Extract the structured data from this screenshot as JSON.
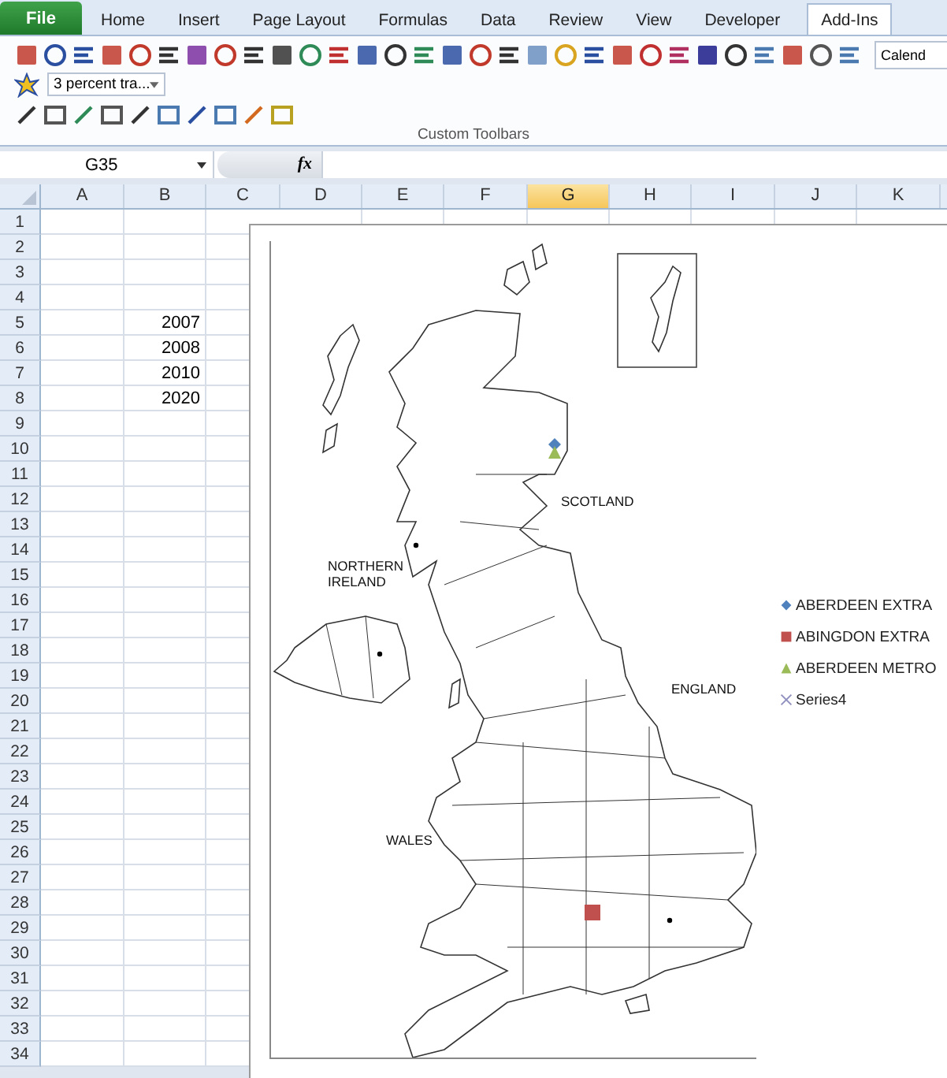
{
  "ribbon": {
    "file_tab": "File",
    "tabs": [
      {
        "label": "Home",
        "selected": false
      },
      {
        "label": "Insert",
        "selected": false
      },
      {
        "label": "Page Layout",
        "selected": false
      },
      {
        "label": "Formulas",
        "selected": false
      },
      {
        "label": "Data",
        "selected": false
      },
      {
        "label": "Review",
        "selected": false
      },
      {
        "label": "View",
        "selected": false
      },
      {
        "label": "Developer",
        "selected": false
      },
      {
        "label": "Add-Ins",
        "selected": true
      }
    ],
    "calendar_field": "Calend",
    "dropdown": "3 percent tra...",
    "group_label": "Custom Toolbars"
  },
  "formula_bar": {
    "name_box": "G35",
    "fx": "fx"
  },
  "sheet": {
    "columns": [
      {
        "label": "A",
        "selected": false
      },
      {
        "label": "B",
        "selected": false
      },
      {
        "label": "C",
        "selected": false
      },
      {
        "label": "D",
        "selected": false
      },
      {
        "label": "E",
        "selected": false
      },
      {
        "label": "F",
        "selected": false
      },
      {
        "label": "G",
        "selected": true
      },
      {
        "label": "H",
        "selected": false
      },
      {
        "label": "I",
        "selected": false
      },
      {
        "label": "J",
        "selected": false
      },
      {
        "label": "K",
        "selected": false
      }
    ],
    "rows": [
      {
        "label": "1"
      },
      {
        "label": "2"
      },
      {
        "label": "3"
      },
      {
        "label": "4"
      },
      {
        "label": "5",
        "B": "2007"
      },
      {
        "label": "6",
        "B": "2008"
      },
      {
        "label": "7",
        "B": "2010"
      },
      {
        "label": "8",
        "B": "2020"
      },
      {
        "label": "9"
      },
      {
        "label": "10"
      },
      {
        "label": "11"
      },
      {
        "label": "12"
      },
      {
        "label": "13"
      },
      {
        "label": "14"
      },
      {
        "label": "15"
      },
      {
        "label": "16"
      },
      {
        "label": "17"
      },
      {
        "label": "18"
      },
      {
        "label": "19"
      },
      {
        "label": "20"
      },
      {
        "label": "21"
      },
      {
        "label": "22"
      },
      {
        "label": "23"
      },
      {
        "label": "24"
      },
      {
        "label": "25"
      },
      {
        "label": "26"
      },
      {
        "label": "27"
      },
      {
        "label": "28"
      },
      {
        "label": "29"
      },
      {
        "label": "30"
      },
      {
        "label": "31"
      },
      {
        "label": "32"
      },
      {
        "label": "33"
      },
      {
        "label": "34"
      }
    ]
  },
  "chart": {
    "region_labels": [
      {
        "label": "SCOTLAND"
      },
      {
        "label": "NORTHERN IRELAND"
      },
      {
        "label": "ENGLAND"
      },
      {
        "label": "WALES"
      }
    ],
    "legend": [
      {
        "label": "ABERDEEN EXTRA",
        "kind": "diamond",
        "color": "#4f81bd"
      },
      {
        "label": "ABINGDON EXTRA",
        "kind": "square",
        "color": "#c0504d"
      },
      {
        "label": "ABERDEEN METRO",
        "kind": "triangle",
        "color": "#9bbb59"
      },
      {
        "label": "Series4",
        "kind": "x",
        "color": "#8f8fc0"
      }
    ]
  }
}
